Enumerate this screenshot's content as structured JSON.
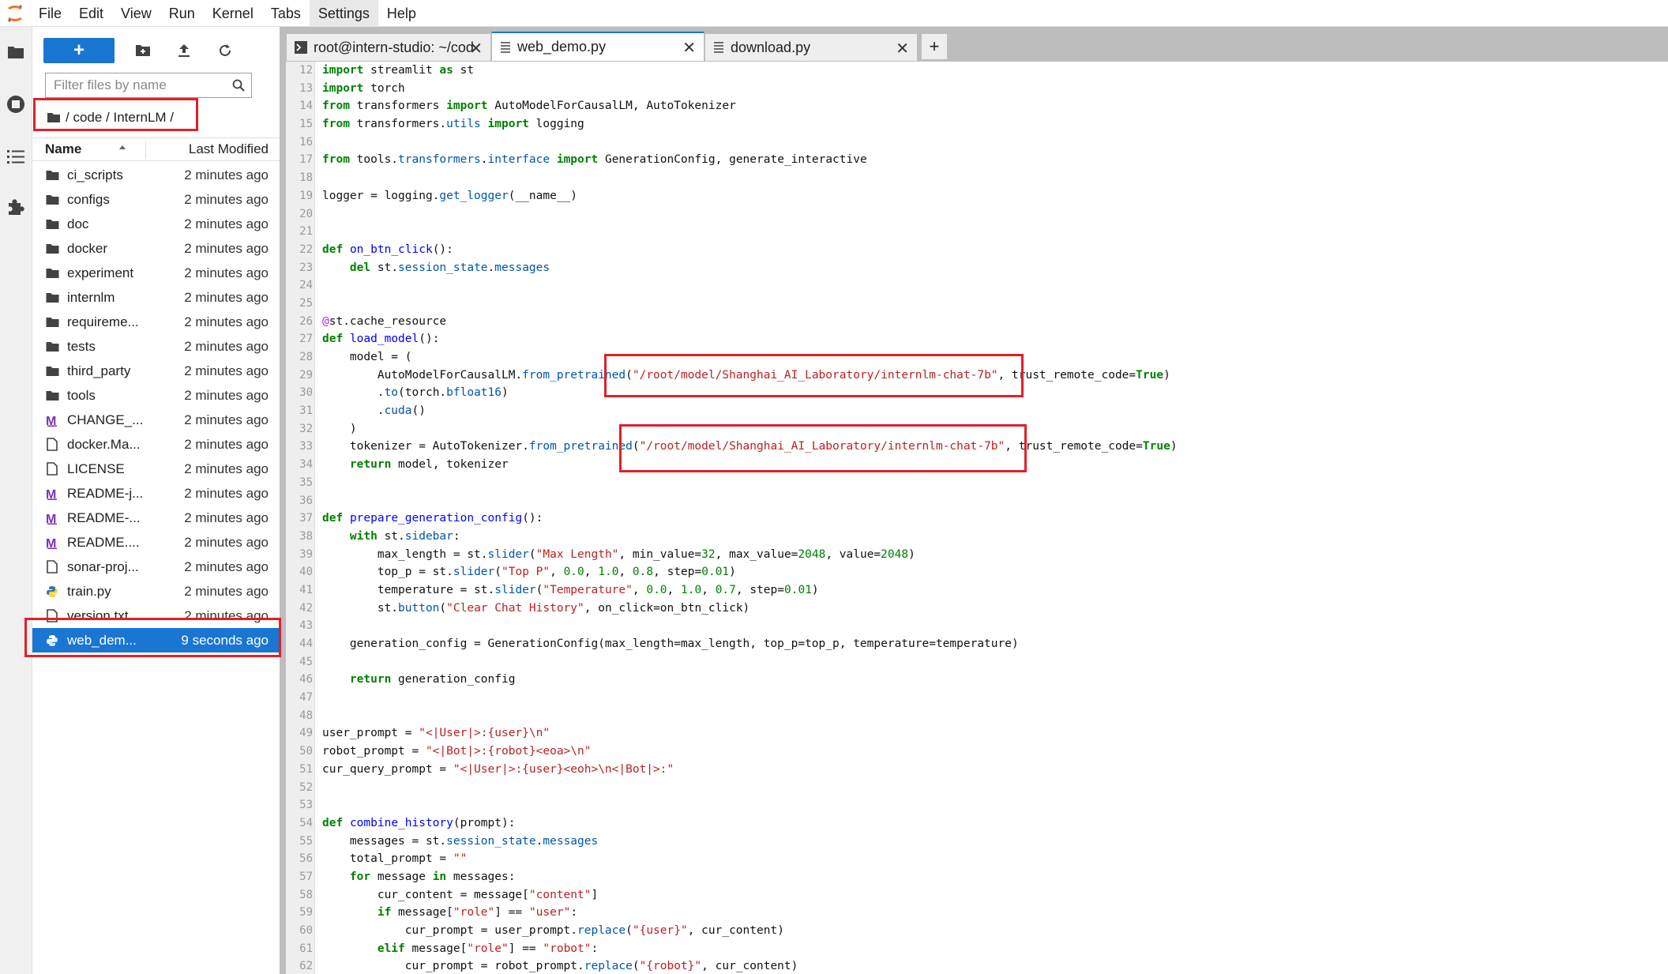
{
  "menubar": {
    "items": [
      "File",
      "Edit",
      "View",
      "Run",
      "Kernel",
      "Tabs",
      "Settings",
      "Help"
    ],
    "active_item": "Settings"
  },
  "filebrowser": {
    "new_label": "+",
    "filter_placeholder": "Filter files by name",
    "breadcrumb": [
      "/ code / InternLM /"
    ],
    "header": {
      "name": "Name",
      "modified": "Last Modified"
    },
    "files": [
      {
        "name": "ci_scripts",
        "modified": "2 minutes ago",
        "type": "folder"
      },
      {
        "name": "configs",
        "modified": "2 minutes ago",
        "type": "folder"
      },
      {
        "name": "doc",
        "modified": "2 minutes ago",
        "type": "folder"
      },
      {
        "name": "docker",
        "modified": "2 minutes ago",
        "type": "folder"
      },
      {
        "name": "experiment",
        "modified": "2 minutes ago",
        "type": "folder"
      },
      {
        "name": "internlm",
        "modified": "2 minutes ago",
        "type": "folder"
      },
      {
        "name": "requireme...",
        "modified": "2 minutes ago",
        "type": "folder"
      },
      {
        "name": "tests",
        "modified": "2 minutes ago",
        "type": "folder"
      },
      {
        "name": "third_party",
        "modified": "2 minutes ago",
        "type": "folder"
      },
      {
        "name": "tools",
        "modified": "2 minutes ago",
        "type": "folder"
      },
      {
        "name": "CHANGE_...",
        "modified": "2 minutes ago",
        "type": "markdown"
      },
      {
        "name": "docker.Ma...",
        "modified": "2 minutes ago",
        "type": "file"
      },
      {
        "name": "LICENSE",
        "modified": "2 minutes ago",
        "type": "file"
      },
      {
        "name": "README-j...",
        "modified": "2 minutes ago",
        "type": "markdown"
      },
      {
        "name": "README-...",
        "modified": "2 minutes ago",
        "type": "markdown"
      },
      {
        "name": "README....",
        "modified": "2 minutes ago",
        "type": "markdown"
      },
      {
        "name": "sonar-proj...",
        "modified": "2 minutes ago",
        "type": "file"
      },
      {
        "name": "train.py",
        "modified": "2 minutes ago",
        "type": "python"
      },
      {
        "name": "version.txt",
        "modified": "2 minutes ago",
        "type": "file"
      },
      {
        "name": "web_dem...",
        "modified": "9 seconds ago",
        "type": "python",
        "selected": true
      }
    ]
  },
  "tabs": [
    {
      "label": "root@intern-studio: ~/cod",
      "icon": "terminal",
      "close": "✕"
    },
    {
      "label": "web_demo.py",
      "icon": "text-file",
      "close": "✕",
      "active": true
    },
    {
      "label": "download.py",
      "icon": "text-file",
      "close": "✕"
    }
  ],
  "add_tab_label": "+",
  "colors": {
    "accent": "#1976d2",
    "annotation": "#e0202a"
  },
  "code_lines": [
    {
      "n": "12",
      "t": "import streamlit as st"
    },
    {
      "n": "13",
      "t": "import torch"
    },
    {
      "n": "14",
      "t": "from transformers import AutoModelForCausalLM, AutoTokenizer"
    },
    {
      "n": "15",
      "t": "from transformers.utils import logging"
    },
    {
      "n": "16",
      "t": ""
    },
    {
      "n": "17",
      "t": "from tools.transformers.interface import GenerationConfig, generate_interactive"
    },
    {
      "n": "18",
      "t": ""
    },
    {
      "n": "19",
      "t": "logger = logging.get_logger(__name__)"
    },
    {
      "n": "20",
      "t": ""
    },
    {
      "n": "21",
      "t": ""
    },
    {
      "n": "22",
      "t": "def on_btn_click():"
    },
    {
      "n": "23",
      "t": "    del st.session_state.messages"
    },
    {
      "n": "24",
      "t": ""
    },
    {
      "n": "25",
      "t": ""
    },
    {
      "n": "26",
      "t": "@st.cache_resource"
    },
    {
      "n": "27",
      "t": "def load_model():"
    },
    {
      "n": "28",
      "t": "    model = ("
    },
    {
      "n": "29",
      "t": "        AutoModelForCausalLM.from_pretrained(\"/root/model/Shanghai_AI_Laboratory/internlm-chat-7b\", trust_remote_code=True)"
    },
    {
      "n": "30",
      "t": "        .to(torch.bfloat16)"
    },
    {
      "n": "31",
      "t": "        .cuda()"
    },
    {
      "n": "32",
      "t": "    )"
    },
    {
      "n": "33",
      "t": "    tokenizer = AutoTokenizer.from_pretrained(\"/root/model/Shanghai_AI_Laboratory/internlm-chat-7b\", trust_remote_code=True)"
    },
    {
      "n": "34",
      "t": "    return model, tokenizer"
    },
    {
      "n": "35",
      "t": ""
    },
    {
      "n": "36",
      "t": ""
    },
    {
      "n": "37",
      "t": "def prepare_generation_config():"
    },
    {
      "n": "38",
      "t": "    with st.sidebar:"
    },
    {
      "n": "39",
      "t": "        max_length = st.slider(\"Max Length\", min_value=32, max_value=2048, value=2048)"
    },
    {
      "n": "40",
      "t": "        top_p = st.slider(\"Top P\", 0.0, 1.0, 0.8, step=0.01)"
    },
    {
      "n": "41",
      "t": "        temperature = st.slider(\"Temperature\", 0.0, 1.0, 0.7, step=0.01)"
    },
    {
      "n": "42",
      "t": "        st.button(\"Clear Chat History\", on_click=on_btn_click)"
    },
    {
      "n": "43",
      "t": ""
    },
    {
      "n": "44",
      "t": "    generation_config = GenerationConfig(max_length=max_length, top_p=top_p, temperature=temperature)"
    },
    {
      "n": "45",
      "t": ""
    },
    {
      "n": "46",
      "t": "    return generation_config"
    },
    {
      "n": "47",
      "t": ""
    },
    {
      "n": "48",
      "t": ""
    },
    {
      "n": "49",
      "t": "user_prompt = \"<|User|>:{user}\\n\""
    },
    {
      "n": "50",
      "t": "robot_prompt = \"<|Bot|>:{robot}<eoa>\\n\""
    },
    {
      "n": "51",
      "t": "cur_query_prompt = \"<|User|>:{user}<eoh>\\n<|Bot|>:\""
    },
    {
      "n": "52",
      "t": ""
    },
    {
      "n": "53",
      "t": ""
    },
    {
      "n": "54",
      "t": "def combine_history(prompt):"
    },
    {
      "n": "55",
      "t": "    messages = st.session_state.messages"
    },
    {
      "n": "56",
      "t": "    total_prompt = \"\""
    },
    {
      "n": "57",
      "t": "    for message in messages:"
    },
    {
      "n": "58",
      "t": "        cur_content = message[\"content\"]"
    },
    {
      "n": "59",
      "t": "        if message[\"role\"] == \"user\":"
    },
    {
      "n": "60",
      "t": "            cur_prompt = user_prompt.replace(\"{user}\", cur_content)"
    },
    {
      "n": "61",
      "t": "        elif message[\"role\"] == \"robot\":"
    },
    {
      "n": "62",
      "t": "            cur_prompt = robot_prompt.replace(\"{robot}\", cur_content)"
    }
  ]
}
